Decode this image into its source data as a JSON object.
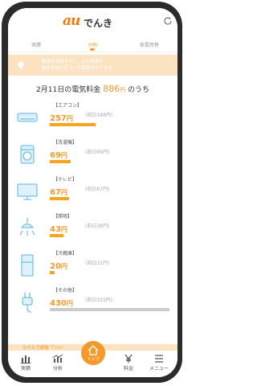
{
  "header": {
    "logo_mark": "au",
    "logo_text": "でんき"
  },
  "tabs": [
    {
      "label": "実績",
      "active": false
    },
    {
      "label": "分析",
      "active": true
    },
    {
      "label": "家電買替",
      "active": false
    }
  ],
  "notice": {
    "text": "家電を登録すると、より実際の\n電気料金に近づく可能性があります"
  },
  "summary": {
    "prefix": "2月11日の電気料金",
    "amount": "886",
    "unit": "円",
    "suffix": "のうち"
  },
  "items": [
    {
      "name": "【エアコン】",
      "price": "257",
      "unit": "円",
      "prev": "(前日188円)",
      "bar_ratio": 0.38,
      "icon": "air-conditioner-icon"
    },
    {
      "name": "【洗濯機】",
      "price": "69",
      "unit": "円",
      "prev": "(前日69円)",
      "bar_ratio": 0.17,
      "icon": "washing-machine-icon"
    },
    {
      "name": "【テレビ】",
      "price": "67",
      "unit": "円",
      "prev": "(前日67円)",
      "bar_ratio": 0.16,
      "icon": "tv-icon"
    },
    {
      "name": "【照明】",
      "price": "43",
      "unit": "円",
      "prev": "(前日38円)",
      "bar_ratio": 0.11,
      "icon": "lighting-icon"
    },
    {
      "name": "【冷蔵庫】",
      "price": "20",
      "unit": "円",
      "prev": "(前日21円)",
      "bar_ratio": 0.04,
      "icon": "refrigerator-icon"
    },
    {
      "name": "【その他】",
      "price": "430",
      "unit": "円",
      "prev": "(前日333円)",
      "bar_ratio": 0.99,
      "icon": "plug-icon",
      "bar_gray": true
    }
  ],
  "bottom_strip": {
    "text": "ひろもで節電 ていい"
  },
  "nav": [
    {
      "label": "実績",
      "icon": "bar-chart-icon"
    },
    {
      "label": "分析",
      "icon": "analysis-icon"
    },
    {
      "label": "トップ",
      "icon": "home-icon"
    },
    {
      "label": "料金",
      "icon": "yen-icon"
    },
    {
      "label": "メニュー",
      "icon": "menu-icon"
    }
  ],
  "colors": {
    "accent": "#f39a2a",
    "bar": "#f7a51e",
    "notice_bg": "#fbe3c2",
    "phone_frame": "#2b2b2b"
  }
}
